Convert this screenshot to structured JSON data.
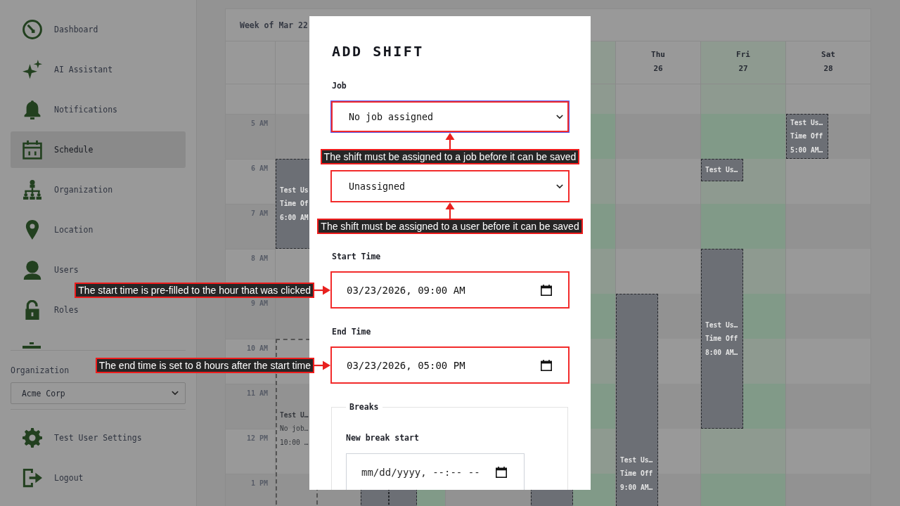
{
  "sidebar": {
    "items": [
      {
        "label": "Dashboard",
        "selected": false
      },
      {
        "label": "AI Assistant",
        "selected": false
      },
      {
        "label": "Notifications",
        "selected": false
      },
      {
        "label": "Schedule",
        "selected": true
      },
      {
        "label": "Organization",
        "selected": false
      },
      {
        "label": "Location",
        "selected": false
      },
      {
        "label": "Users",
        "selected": false
      },
      {
        "label": "Roles",
        "selected": false
      },
      {
        "selected": false
      }
    ],
    "organization": {
      "label": "Organization",
      "value": "Acme Corp"
    },
    "footer_items": [
      {
        "label": "Test User Settings"
      },
      {
        "label": "Logout"
      }
    ]
  },
  "calendar": {
    "title": "Week of Mar 22",
    "hours": [
      "5 AM",
      "6 AM",
      "7 AM",
      "8 AM",
      "9 AM",
      "10 AM",
      "11 AM",
      "12 PM",
      "1 PM"
    ],
    "days": [
      {
        "highlighted": false,
        "events": [
          {
            "kind": "filled",
            "lines": [
              "Test Us",
              "Time Of",
              "6:00 AM"
            ]
          },
          {
            "kind": "draft",
            "lines": [
              "Test U…",
              "No job…",
              "10:00 …"
            ]
          }
        ]
      },
      {
        "highlighted": true,
        "events": [
          {
            "kind": "filled"
          },
          {
            "kind": "filled"
          }
        ]
      },
      {
        "highlighted": false
      },
      {
        "highlighted": true,
        "events": [
          {
            "kind": "filled"
          }
        ]
      },
      {
        "label": "Thu",
        "date": "26",
        "highlighted": false,
        "events": [
          {
            "kind": "filled",
            "lines": [
              "Test Us…",
              "Time Off",
              "9:00 AM…"
            ]
          }
        ]
      },
      {
        "label": "Fri",
        "date": "27",
        "highlighted": true,
        "events": [
          {
            "kind": "filled",
            "lines": [
              "Test Us…"
            ]
          },
          {
            "kind": "filled",
            "lines": [
              "Test Us…",
              "Time Off",
              "8:00 AM…"
            ]
          }
        ]
      },
      {
        "label": "Sat",
        "date": "28",
        "highlighted": false,
        "events": [
          {
            "kind": "filled",
            "lines": [
              "Test Us…",
              "Time Off",
              "5:00 AM…"
            ]
          }
        ]
      }
    ]
  },
  "modal": {
    "title": "ADD SHIFT",
    "fields": [
      {
        "kind": "select",
        "label": "Job",
        "value": "No job assigned",
        "highlighted": true,
        "focused": true,
        "callout": {
          "kind": "below",
          "text": "The shift must be assigned to a job before it can be saved"
        }
      },
      {
        "kind": "select",
        "value": "Unassigned",
        "highlighted": true,
        "focused": false,
        "callout": {
          "kind": "below",
          "text": "The shift must be assigned to a user before it can be saved"
        }
      },
      {
        "kind": "datetime",
        "label": "Start Time",
        "value": "03/23/2026, 09:00 AM",
        "highlighted": true,
        "focused": false,
        "callout": {
          "kind": "left",
          "text": "The start time is pre-filled to the hour that was clicked"
        }
      },
      {
        "kind": "datetime",
        "label": "End Time",
        "value": "03/23/2026, 05:00 PM",
        "highlighted": true,
        "focused": false,
        "callout": {
          "kind": "left",
          "text": "The end time is set to 8 hours after the start time"
        }
      }
    ],
    "breaks": {
      "legend": "Breaks",
      "label": "New break start",
      "placeholder": "mm/dd/yyyy, --:-- --"
    }
  }
}
